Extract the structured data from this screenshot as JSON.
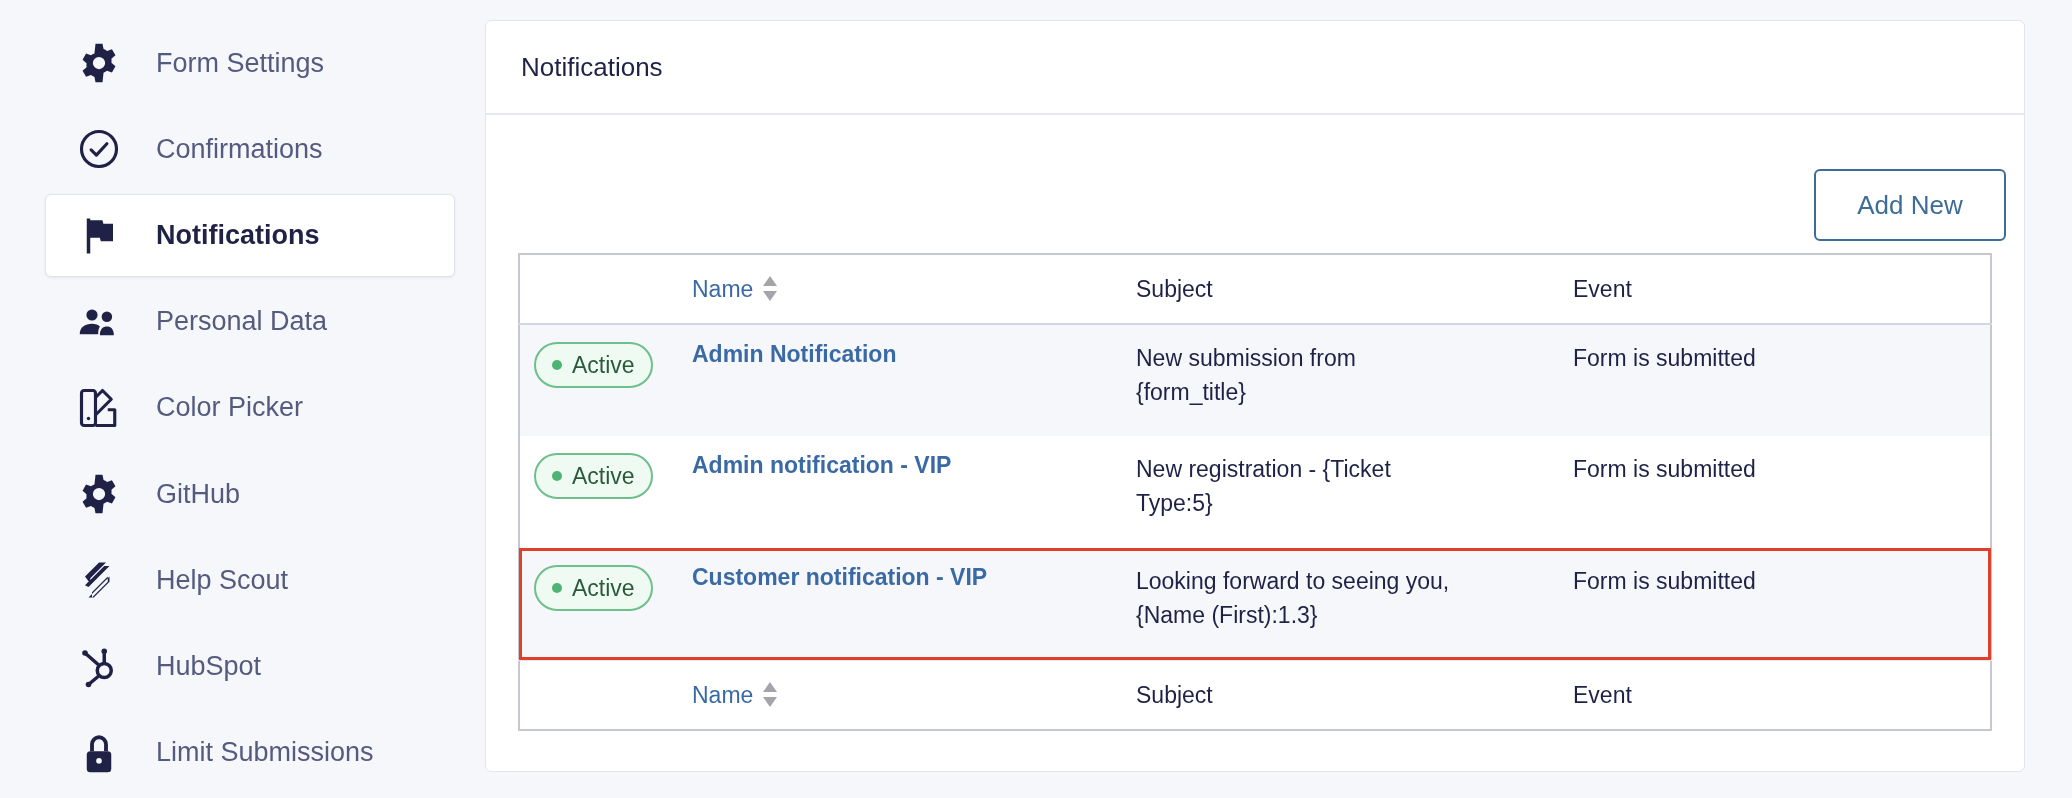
{
  "sidebar": {
    "items": [
      {
        "label": "Form Settings",
        "kind": "gear",
        "selected": false
      },
      {
        "label": "Confirmations",
        "kind": "check",
        "selected": false
      },
      {
        "label": "Notifications",
        "kind": "flag",
        "selected": true
      },
      {
        "label": "Personal Data",
        "kind": "users",
        "selected": false
      },
      {
        "label": "Color Picker",
        "kind": "swatch",
        "selected": false
      },
      {
        "label": "GitHub",
        "kind": "gear",
        "selected": false
      },
      {
        "label": "Help Scout",
        "kind": "slashes",
        "selected": false
      },
      {
        "label": "HubSpot",
        "kind": "hub",
        "selected": false
      },
      {
        "label": "Limit Submissions",
        "kind": "lock",
        "selected": false
      }
    ]
  },
  "panel": {
    "title": "Notifications",
    "add_button": "Add New",
    "table": {
      "columns": [
        {
          "label": "Name",
          "sortable": true
        },
        {
          "label": "Subject",
          "sortable": false
        },
        {
          "label": "Event",
          "sortable": false
        }
      ],
      "rows": [
        {
          "status": "Active",
          "name": "Admin Notification",
          "subject": "New submission from {form_title}",
          "event": "Form is submitted",
          "highlighted": false
        },
        {
          "status": "Active",
          "name": "Admin notification - VIP",
          "subject": "New registration - {Ticket Type:5}",
          "event": "Form is submitted",
          "highlighted": false
        },
        {
          "status": "Active",
          "name": "Customer notification - VIP",
          "subject": "Looking forward to seeing you, {Name (First):1.3}",
          "event": "Form is submitted",
          "highlighted": true
        }
      ],
      "footer_columns": [
        {
          "label": "Name",
          "sortable": true
        },
        {
          "label": "Subject",
          "sortable": false
        },
        {
          "label": "Event",
          "sortable": false
        }
      ]
    }
  }
}
